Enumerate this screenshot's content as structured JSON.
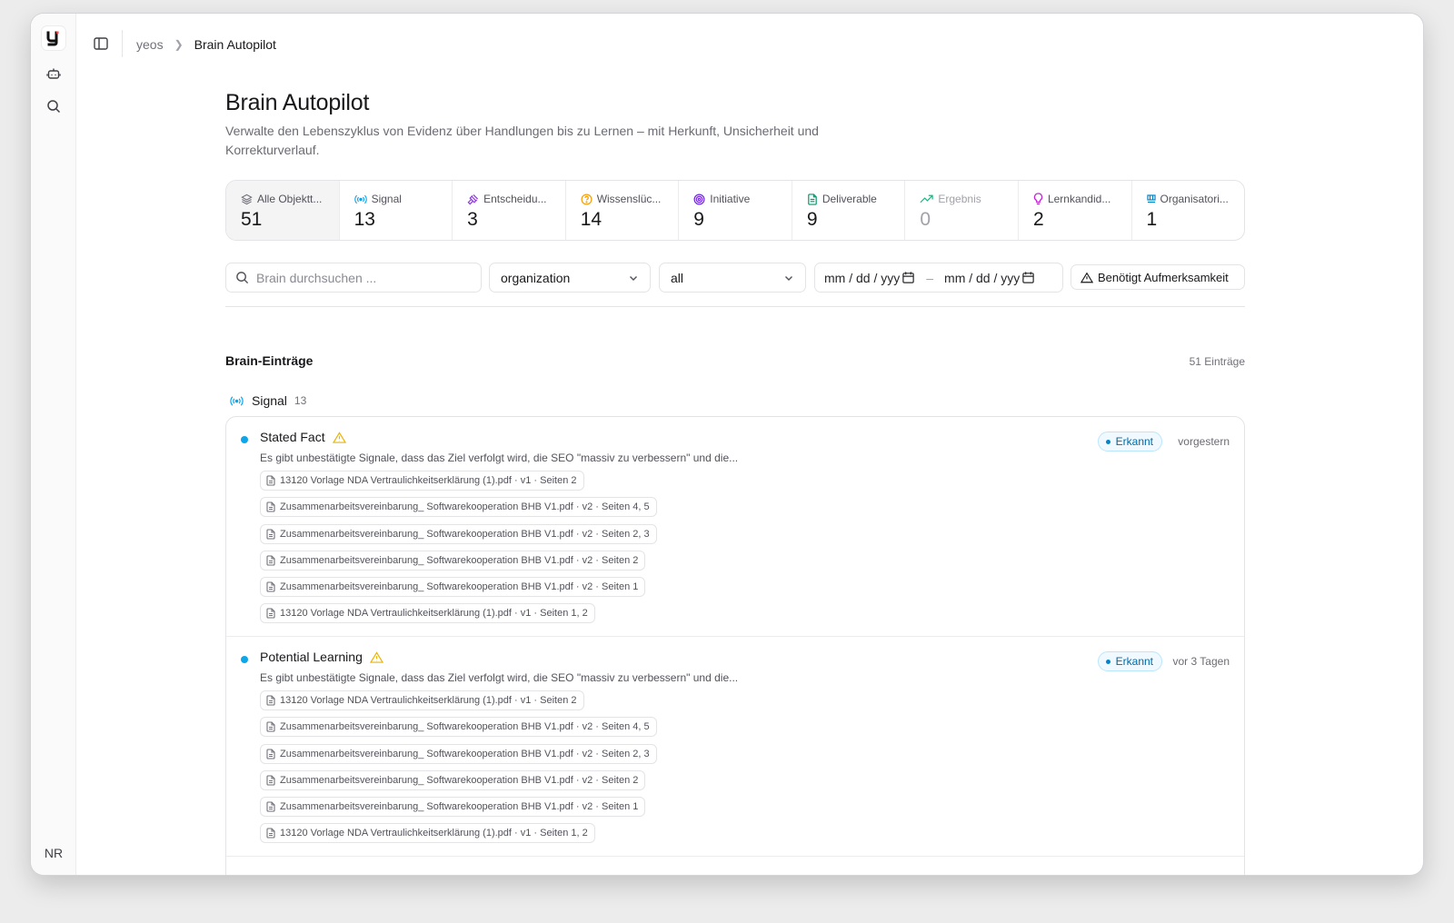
{
  "rail": {
    "logo": "y",
    "avatar": "NR",
    "icons": [
      "bot-icon",
      "search-icon"
    ]
  },
  "breadcrumb": {
    "root": "yeos",
    "current": "Brain Autopilot"
  },
  "page": {
    "title": "Brain Autopilot",
    "subtitle": "Verwalte den Lebenszyklus von Evidenz über Handlungen bis zu Lernen – mit Herkunft, Unsicherheit und Korrekturverlauf."
  },
  "stats": [
    {
      "label": "Alle Objektt...",
      "value": "51",
      "icon": "layers-icon"
    },
    {
      "label": "Signal",
      "value": "13",
      "icon": "signal-icon"
    },
    {
      "label": "Entscheidu...",
      "value": "3",
      "icon": "gavel-icon"
    },
    {
      "label": "Wissenslüc...",
      "value": "14",
      "icon": "help-circle-icon"
    },
    {
      "label": "Initiative",
      "value": "9",
      "icon": "target-icon"
    },
    {
      "label": "Deliverable",
      "value": "9",
      "icon": "file-icon"
    },
    {
      "label": "Ergebnis",
      "value": "0",
      "icon": "trending-up-icon"
    },
    {
      "label": "Lernkandid...",
      "value": "2",
      "icon": "lightbulb-icon"
    },
    {
      "label": "Organisatori...",
      "value": "1",
      "icon": "org-icon"
    }
  ],
  "filters": {
    "search_placeholder": "Brain durchsuchen ...",
    "scope": "organization",
    "status": "all",
    "date_from": "mm / dd / yyy",
    "date_to": "mm / dd / yyy",
    "attention": "Benötigt Aufmerksamkeit"
  },
  "section": {
    "title": "Brain-Einträge",
    "count": "51 Einträge"
  },
  "group": {
    "label": "Signal",
    "count": "13"
  },
  "entries": [
    {
      "title": "Stated Fact",
      "description": "Es gibt unbestätigte Signale, dass das Ziel verfolgt wird, die SEO \"massiv zu verbessern\" und die...",
      "badge": "Erkannt",
      "time": "vorgestern",
      "sources": [
        "13120 Vorlage NDA Vertraulichkeitserklärung (1).pdf · v1 · Seiten 2",
        "Zusammenarbeitsvereinbarung_ Softwarekooperation BHB V1.pdf · v2 · Seiten 4, 5",
        "Zusammenarbeitsvereinbarung_ Softwarekooperation BHB V1.pdf · v2 · Seiten 2, 3",
        "Zusammenarbeitsvereinbarung_ Softwarekooperation BHB V1.pdf · v2 · Seiten 2",
        "Zusammenarbeitsvereinbarung_ Softwarekooperation BHB V1.pdf · v2 · Seiten 1",
        "13120 Vorlage NDA Vertraulichkeitserklärung (1).pdf · v1 · Seiten 1, 2"
      ]
    },
    {
      "title": "Potential Learning",
      "description": "Es gibt unbestätigte Signale, dass das Ziel verfolgt wird, die SEO \"massiv zu verbessern\" und die...",
      "badge": "Erkannt",
      "time": "vor 3 Tagen",
      "sources": [
        "13120 Vorlage NDA Vertraulichkeitserklärung (1).pdf · v1 · Seiten 2",
        "Zusammenarbeitsvereinbarung_ Softwarekooperation BHB V1.pdf · v2 · Seiten 4, 5",
        "Zusammenarbeitsvereinbarung_ Softwarekooperation BHB V1.pdf · v2 · Seiten 2, 3",
        "Zusammenarbeitsvereinbarung_ Softwarekooperation BHB V1.pdf · v2 · Seiten 2",
        "Zusammenarbeitsvereinbarung_ Softwarekooperation BHB V1.pdf · v2 · Seiten 1",
        "13120 Vorlage NDA Vertraulichkeitserklärung (1).pdf · v1 · Seiten 1, 2"
      ]
    }
  ],
  "colors": {
    "accent": "#0ea5e9",
    "warning": "#eab308",
    "badge_text": "#0369a1",
    "signal": "#0ea5e9",
    "decision": "#9333ea",
    "gap": "#f59e0b",
    "initiative": "#6d28d9",
    "deliverable": "#059669",
    "result": "#10b981",
    "learning": "#c026d3",
    "org": "#0284c7"
  }
}
